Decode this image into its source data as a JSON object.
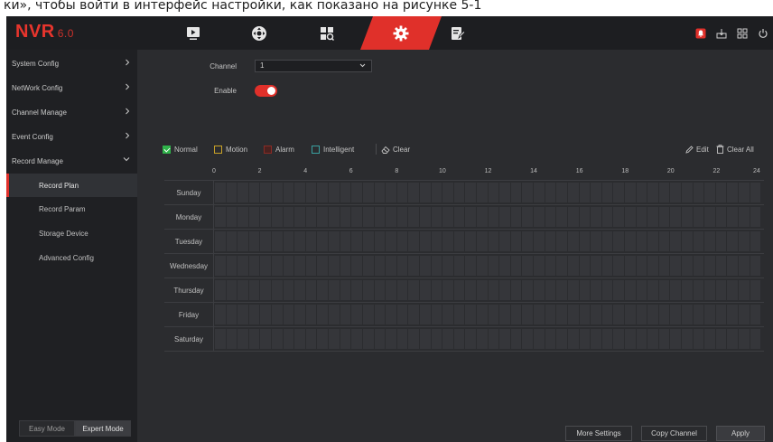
{
  "caption": "ки», чтобы войти в интерфейс настройки, как показано на рисунке 5-1",
  "app": {
    "logo_text": "NVR",
    "logo_version": "6.0",
    "accent_color": "#e0302a"
  },
  "top_nav": {
    "items": [
      {
        "name": "playback",
        "icon": "play-icon"
      },
      {
        "name": "ptz",
        "icon": "ptz-icon"
      },
      {
        "name": "search",
        "icon": "search-grid-icon"
      },
      {
        "name": "settings",
        "icon": "gear-icon",
        "active": true
      },
      {
        "name": "maintenance",
        "icon": "edit-icon"
      }
    ],
    "right_icons": [
      "alarm-icon",
      "user-icon",
      "layout-icon",
      "power-icon"
    ]
  },
  "sidebar": {
    "items": [
      {
        "label": "System Config"
      },
      {
        "label": "NetWork Config"
      },
      {
        "label": "Channel Manage"
      },
      {
        "label": "Event Config"
      },
      {
        "label": "Record Manage",
        "expanded": true
      }
    ],
    "sub_items": [
      {
        "label": "Record Plan",
        "active": true
      },
      {
        "label": "Record Param"
      },
      {
        "label": "Storage Device"
      },
      {
        "label": "Advanced Config"
      }
    ],
    "mode": {
      "easy": "Easy Mode",
      "expert": "Expert Mode",
      "selected": "expert"
    }
  },
  "form": {
    "channel_label": "Channel",
    "channel_value": "1",
    "enable_label": "Enable",
    "enable_on": true
  },
  "legend": {
    "normal": "Normal",
    "motion": "Motion",
    "alarm": "Alarm",
    "intelligent": "Intelligent",
    "clear": "Clear",
    "normal_color": "#2fb34a",
    "motion_color": "#c9a227",
    "alarm_color": "#8a2b25",
    "intelligent_color": "#3aa0a0"
  },
  "tools": {
    "edit": "Edit",
    "clear_all": "Clear All"
  },
  "schedule": {
    "hour_labels": [
      "0",
      "2",
      "4",
      "6",
      "8",
      "10",
      "12",
      "14",
      "16",
      "18",
      "20",
      "22",
      "24"
    ],
    "days": [
      "Sunday",
      "Monday",
      "Tuesday",
      "Wednesday",
      "Thursday",
      "Friday",
      "Saturday"
    ]
  },
  "buttons": {
    "more_settings": "More Settings",
    "copy_channel": "Copy Channel",
    "apply": "Apply"
  }
}
